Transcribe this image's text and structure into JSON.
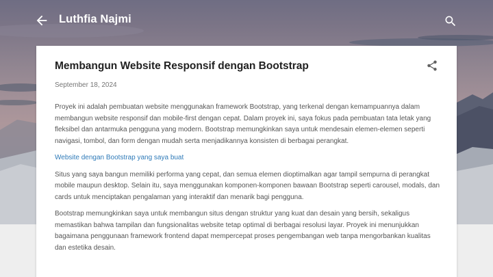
{
  "header": {
    "blog_title": "Luthfia Najmi",
    "back_icon": "arrow-back-icon",
    "search_icon": "search-icon"
  },
  "post": {
    "title": "Membangun Website Responsif dengan Bootstrap",
    "date": "September 18, 2024",
    "share_icon": "share-icon",
    "paragraphs": [
      "Proyek ini adalah pembuatan website menggunakan framework Bootstrap, yang terkenal dengan kemampuannya dalam membangun website responsif dan mobile-first dengan cepat. Dalam proyek ini, saya fokus pada pembuatan tata letak yang fleksibel dan antarmuka pengguna yang modern. Bootstrap memungkinkan saya untuk mendesain elemen-elemen seperti navigasi, tombol, dan form dengan mudah serta menjadikannya konsisten di berbagai perangkat.",
      "Situs yang saya bangun memiliki performa yang cepat, dan semua elemen dioptimalkan agar tampil sempurna di perangkat mobile maupun desktop. Selain itu, saya menggunakan komponen-komponen bawaan Bootstrap seperti carousel, modals, dan cards untuk menciptakan pengalaman yang interaktif dan menarik bagi pengguna.",
      "Bootstrap memungkinkan saya untuk membangun situs dengan struktur yang kuat dan desain yang bersih, sekaligus memastikan bahwa tampilan dan fungsionalitas website tetap optimal di berbagai resolusi layar. Proyek ini menunjukkan bagaimana penggunaan framework frontend dapat mempercepat proses pengembangan web tanpa mengorbankan kualitas dan estetika desain."
    ],
    "link_text": "Website dengan Bootstrap yang saya buat"
  },
  "colors": {
    "link": "#2e7ab8",
    "title_text": "#212121",
    "body_text": "#555555",
    "date_text": "#757575",
    "header_text": "#ffffff"
  }
}
